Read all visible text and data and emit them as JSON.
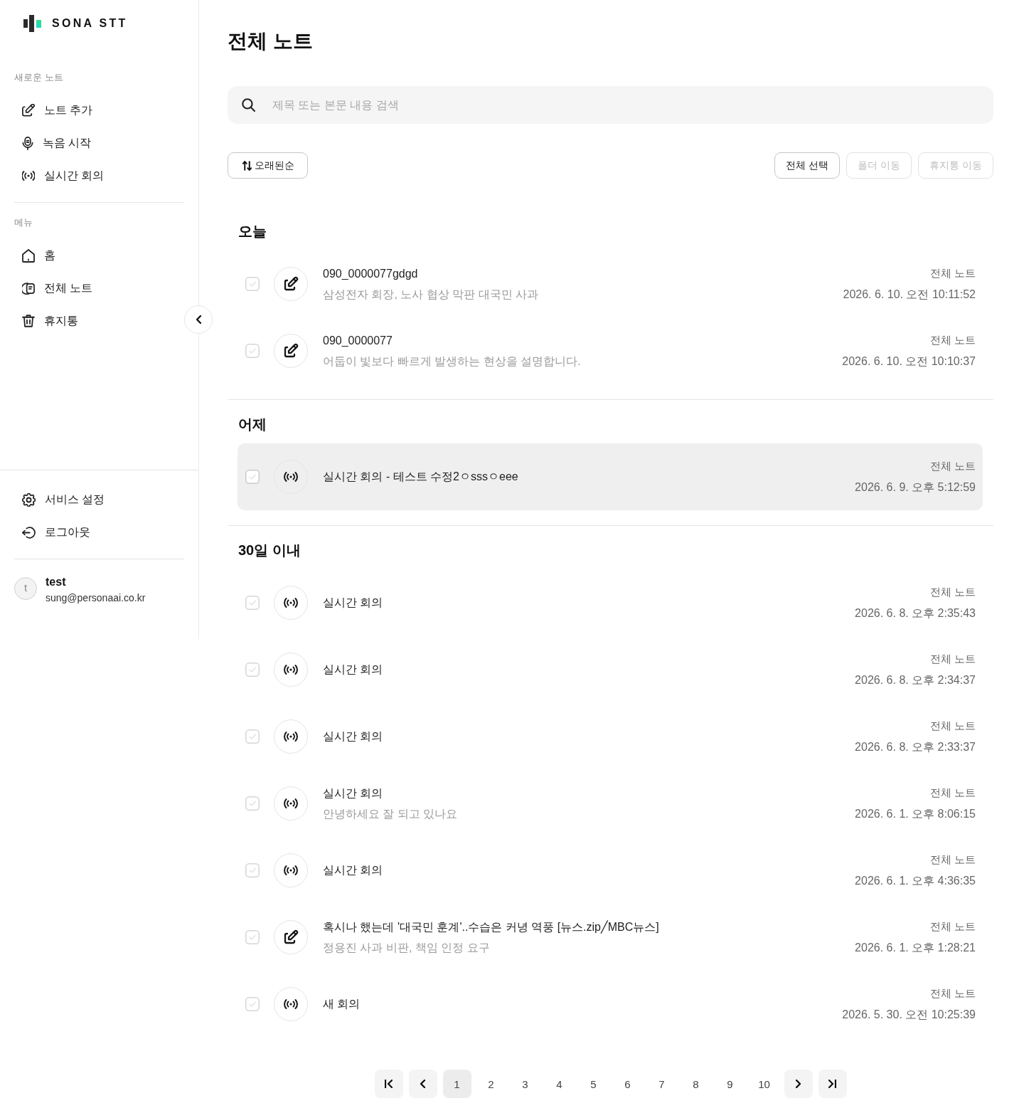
{
  "sidebar": {
    "logo": {
      "text": "SONA STT"
    },
    "sections": [
      {
        "label": "새로운 노트",
        "items": [
          {
            "kind": "add-note",
            "label": "노트 추가"
          },
          {
            "kind": "record",
            "label": "녹음 시작"
          },
          {
            "kind": "live",
            "label": "실시간 회의"
          }
        ]
      },
      {
        "label": "메뉴",
        "items": [
          {
            "kind": "home",
            "label": "홈"
          },
          {
            "kind": "notes",
            "label": "전체 노트"
          },
          {
            "kind": "trash",
            "label": "휴지통"
          }
        ]
      }
    ],
    "footer_items": [
      {
        "kind": "settings",
        "label": "서비스 설정"
      },
      {
        "kind": "logout",
        "label": "로그아웃"
      }
    ],
    "user": {
      "initial": "t",
      "name": "test",
      "email": "sung@personaai.co.kr"
    }
  },
  "page_title": "전체 노트",
  "search": {
    "placeholder": "제목 또는 본문 내용 검색"
  },
  "toolbar": {
    "sort": {
      "label": "오래된순"
    },
    "actions": [
      {
        "label": "전체 선택",
        "disabled": false
      },
      {
        "label": "폴더 이동",
        "disabled": true
      },
      {
        "label": "휴지통 이동",
        "disabled": true
      }
    ]
  },
  "groups": [
    {
      "heading": "오늘",
      "notes": [
        {
          "checked": false,
          "kind": "note",
          "title": "090_0000077gdgd",
          "preview": "삼성전자 회장, 노사 협상 막판 대국민 사과",
          "folder": "전체 노트",
          "date": "2026. 6. 10. 오전 10:11:52",
          "highlighted": false
        },
        {
          "checked": false,
          "kind": "note",
          "title": "090_0000077",
          "preview": "어둡이 빛보다 빠르게 발생하는 현상을 설명합니다.",
          "folder": "전체 노트",
          "date": "2026. 6. 10. 오전 10:10:37",
          "highlighted": false
        }
      ]
    },
    {
      "heading": "어제",
      "notes": [
        {
          "checked": false,
          "kind": "live",
          "title": "실시간 회의 - 테스트 수정2ㅇsssㅇeee",
          "folder": "전체 노트",
          "date": "2026. 6. 9. 오후 5:12:59",
          "highlighted": true
        }
      ]
    },
    {
      "heading": "30일 이내",
      "notes": [
        {
          "checked": false,
          "kind": "live",
          "title": "실시간 회의",
          "folder": "전체 노트",
          "date": "2026. 6. 8. 오후 2:35:43",
          "highlighted": false
        },
        {
          "checked": false,
          "kind": "live",
          "title": "실시간 회의",
          "folder": "전체 노트",
          "date": "2026. 6. 8. 오후 2:34:37",
          "highlighted": false
        },
        {
          "checked": false,
          "kind": "live",
          "title": "실시간 회의",
          "folder": "전체 노트",
          "date": "2026. 6. 8. 오후 2:33:37",
          "highlighted": false
        },
        {
          "checked": false,
          "kind": "live",
          "title": "실시간 회의",
          "preview": "안녕하세요 잘 되고 있나요",
          "folder": "전체 노트",
          "date": "2026. 6. 1. 오후 8:06:15",
          "highlighted": false
        },
        {
          "checked": false,
          "kind": "live",
          "title": "실시간 회의",
          "folder": "전체 노트",
          "date": "2026. 6. 1. 오후 4:36:35",
          "highlighted": false
        },
        {
          "checked": false,
          "kind": "note",
          "title": "혹시나 했는데 '대국민 훈계'..수습은 커녕 역풍 [뉴스.zip╱MBC뉴스]",
          "preview": "정용진 사과 비판, 책임 인정 요구",
          "folder": "전체 노트",
          "date": "2026. 6. 1. 오후 1:28:21",
          "highlighted": false
        },
        {
          "checked": false,
          "kind": "live",
          "title": "새 회의",
          "folder": "전체 노트",
          "date": "2026. 5. 30. 오전 10:25:39",
          "highlighted": false
        }
      ]
    }
  ],
  "pagination": {
    "pages": [
      {
        "label": "1",
        "selected": true
      },
      {
        "label": "2",
        "selected": false
      },
      {
        "label": "3",
        "selected": false
      },
      {
        "label": "4",
        "selected": false
      },
      {
        "label": "5",
        "selected": false
      },
      {
        "label": "6",
        "selected": false
      },
      {
        "label": "7",
        "selected": false
      },
      {
        "label": "8",
        "selected": false
      },
      {
        "label": "9",
        "selected": false
      },
      {
        "label": "10",
        "selected": false
      }
    ]
  }
}
